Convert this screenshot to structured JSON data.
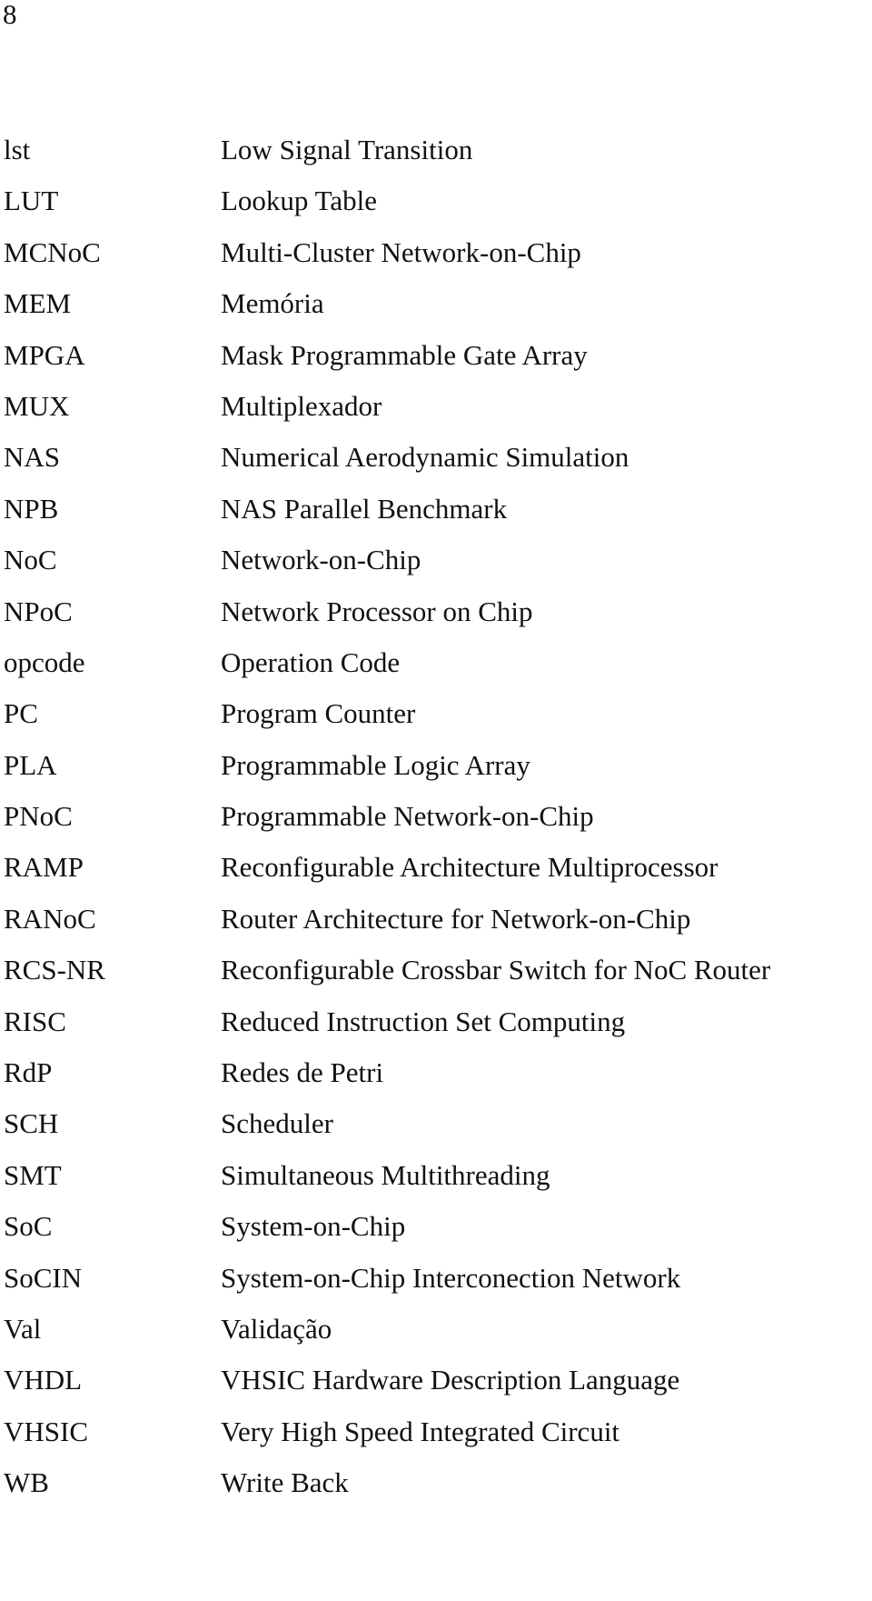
{
  "page": {
    "number": "8"
  },
  "abbreviations": [
    {
      "abbr": "lst",
      "desc": "Low Signal Transition"
    },
    {
      "abbr": "LUT",
      "desc": "Lookup Table"
    },
    {
      "abbr": "MCNoC",
      "desc": "Multi-Cluster Network-on-Chip"
    },
    {
      "abbr": "MEM",
      "desc": "Memória"
    },
    {
      "abbr": "MPGA",
      "desc": "Mask Programmable Gate Array"
    },
    {
      "abbr": "MUX",
      "desc": "Multiplexador"
    },
    {
      "abbr": "NAS",
      "desc": "Numerical Aerodynamic Simulation"
    },
    {
      "abbr": "NPB",
      "desc": "NAS Parallel Benchmark"
    },
    {
      "abbr": "NoC",
      "desc": "Network-on-Chip"
    },
    {
      "abbr": "NPoC",
      "desc": "Network Processor on Chip"
    },
    {
      "abbr": "opcode",
      "desc": "Operation Code"
    },
    {
      "abbr": "PC",
      "desc": "Program Counter"
    },
    {
      "abbr": "PLA",
      "desc": "Programmable Logic Array"
    },
    {
      "abbr": "PNoC",
      "desc": "Programmable Network-on-Chip"
    },
    {
      "abbr": "RAMP",
      "desc": "Reconfigurable Architecture Multiprocessor"
    },
    {
      "abbr": "RANoC",
      "desc": "Router Architecture for Network-on-Chip"
    },
    {
      "abbr": "RCS-NR",
      "desc": "Reconfigurable Crossbar Switch for NoC Router"
    },
    {
      "abbr": "RISC",
      "desc": "Reduced Instruction Set Computing"
    },
    {
      "abbr": "RdP",
      "desc": "Redes de Petri"
    },
    {
      "abbr": "SCH",
      "desc": "Scheduler"
    },
    {
      "abbr": "SMT",
      "desc": "Simultaneous Multithreading"
    },
    {
      "abbr": "SoC",
      "desc": "System-on-Chip"
    },
    {
      "abbr": "SoCIN",
      "desc": "System-on-Chip Interconection Network"
    },
    {
      "abbr": "Val",
      "desc": "Validação"
    },
    {
      "abbr": "VHDL",
      "desc": "VHSIC Hardware Description Language"
    },
    {
      "abbr": "VHSIC",
      "desc": "Very High Speed Integrated Circuit"
    },
    {
      "abbr": "WB",
      "desc": "Write Back"
    }
  ]
}
